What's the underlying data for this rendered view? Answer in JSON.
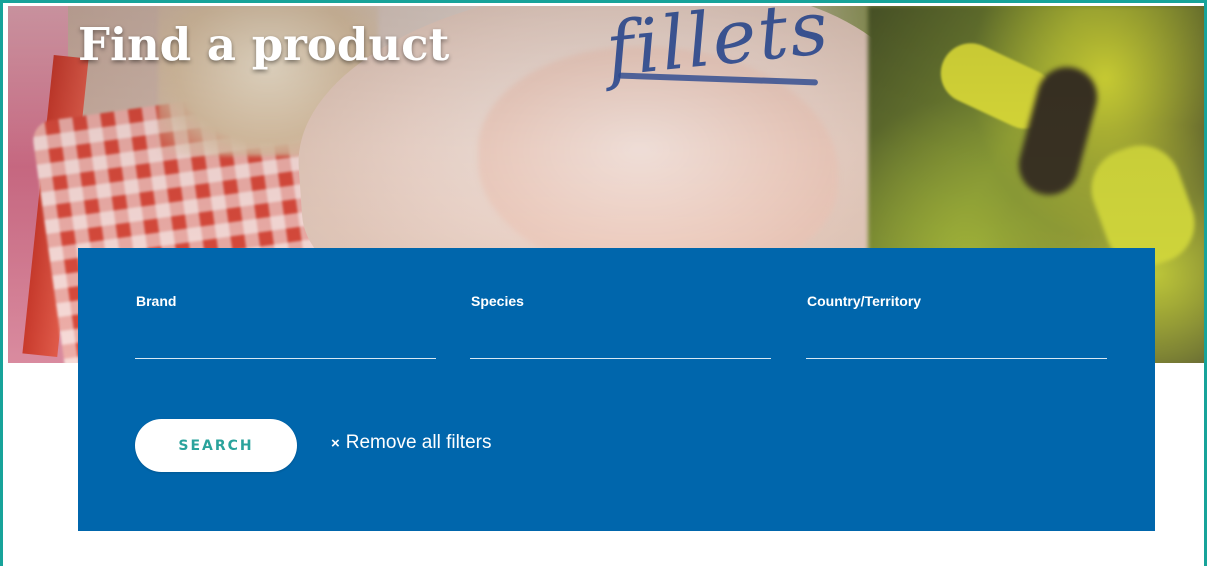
{
  "page": {
    "title": "Find a product"
  },
  "hero": {
    "packaging_text": "fillets"
  },
  "filters": {
    "brand": {
      "label": "Brand",
      "value": "",
      "placeholder": ""
    },
    "species": {
      "label": "Species",
      "value": "",
      "placeholder": ""
    },
    "country": {
      "label": "Country/Territory",
      "value": "",
      "placeholder": ""
    },
    "search_button_label": "SEARCH",
    "remove_filters": {
      "icon": "close-icon",
      "icon_glyph": "×",
      "label": "Remove all filters"
    }
  },
  "colors": {
    "panel_blue": "#0066ac",
    "accent_teal": "#2aa39c",
    "frame_teal": "#17a39a",
    "white": "#ffffff"
  }
}
